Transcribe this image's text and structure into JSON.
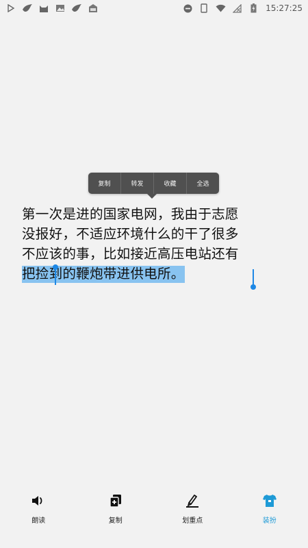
{
  "status_bar": {
    "time": "15:27:25",
    "left_icons": [
      "play-store-icon",
      "bird-icon",
      "cat-icon",
      "image-icon",
      "bird-icon",
      "store-icon"
    ],
    "right_icons": [
      "dnd-icon",
      "phone-icon",
      "wifi-icon",
      "no-signal-icon",
      "battery-charging-icon"
    ]
  },
  "context_menu": {
    "items": [
      {
        "label": "复制"
      },
      {
        "label": "转发"
      },
      {
        "label": "收藏"
      },
      {
        "label": "全选"
      }
    ]
  },
  "article": {
    "lines": [
      "第一次是进的国家电网，我由于志愿",
      "没报好，不适应环境什么的干了很多",
      "不应该的事，比如接近高压电站还有"
    ],
    "selected_line": "把捡到的鞭炮带进供电所。"
  },
  "toolbar": {
    "items": [
      {
        "label": "朗读",
        "icon": "speaker-icon"
      },
      {
        "label": "复制",
        "icon": "copy-icon"
      },
      {
        "label": "划重点",
        "icon": "highlight-pen-icon"
      },
      {
        "label": "装扮",
        "icon": "shirt-icon",
        "active": true
      }
    ],
    "active_color": "#1e9ad6",
    "selection_color": "#88c3f0",
    "handle_color": "#1e88e5"
  }
}
